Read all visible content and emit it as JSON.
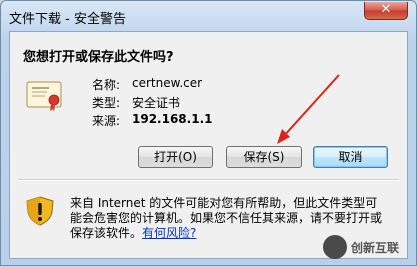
{
  "window": {
    "title": "文件下载 - 安全警告",
    "close_label": "✕"
  },
  "dialog": {
    "question": "您想打开或保存此文件吗?",
    "fields": [
      {
        "label": "名称:",
        "value": "certnew.cer"
      },
      {
        "label": "类型:",
        "value": "安全证书"
      },
      {
        "label": "来源:",
        "value": "192.168.1.1"
      }
    ],
    "buttons": {
      "open": "打开(O)",
      "save": "保存(S)",
      "cancel": "取消"
    }
  },
  "warning": {
    "text": "来自 Internet 的文件可能对您有所帮助，但此文件类型可能会危害您的计算机。如果您不信任其来源，请不要打开或保存该软件。",
    "link": "有何风险?"
  },
  "watermark": {
    "text": "创新互联"
  },
  "colors": {
    "arrow": "#e0201a",
    "link": "#0033cc"
  }
}
